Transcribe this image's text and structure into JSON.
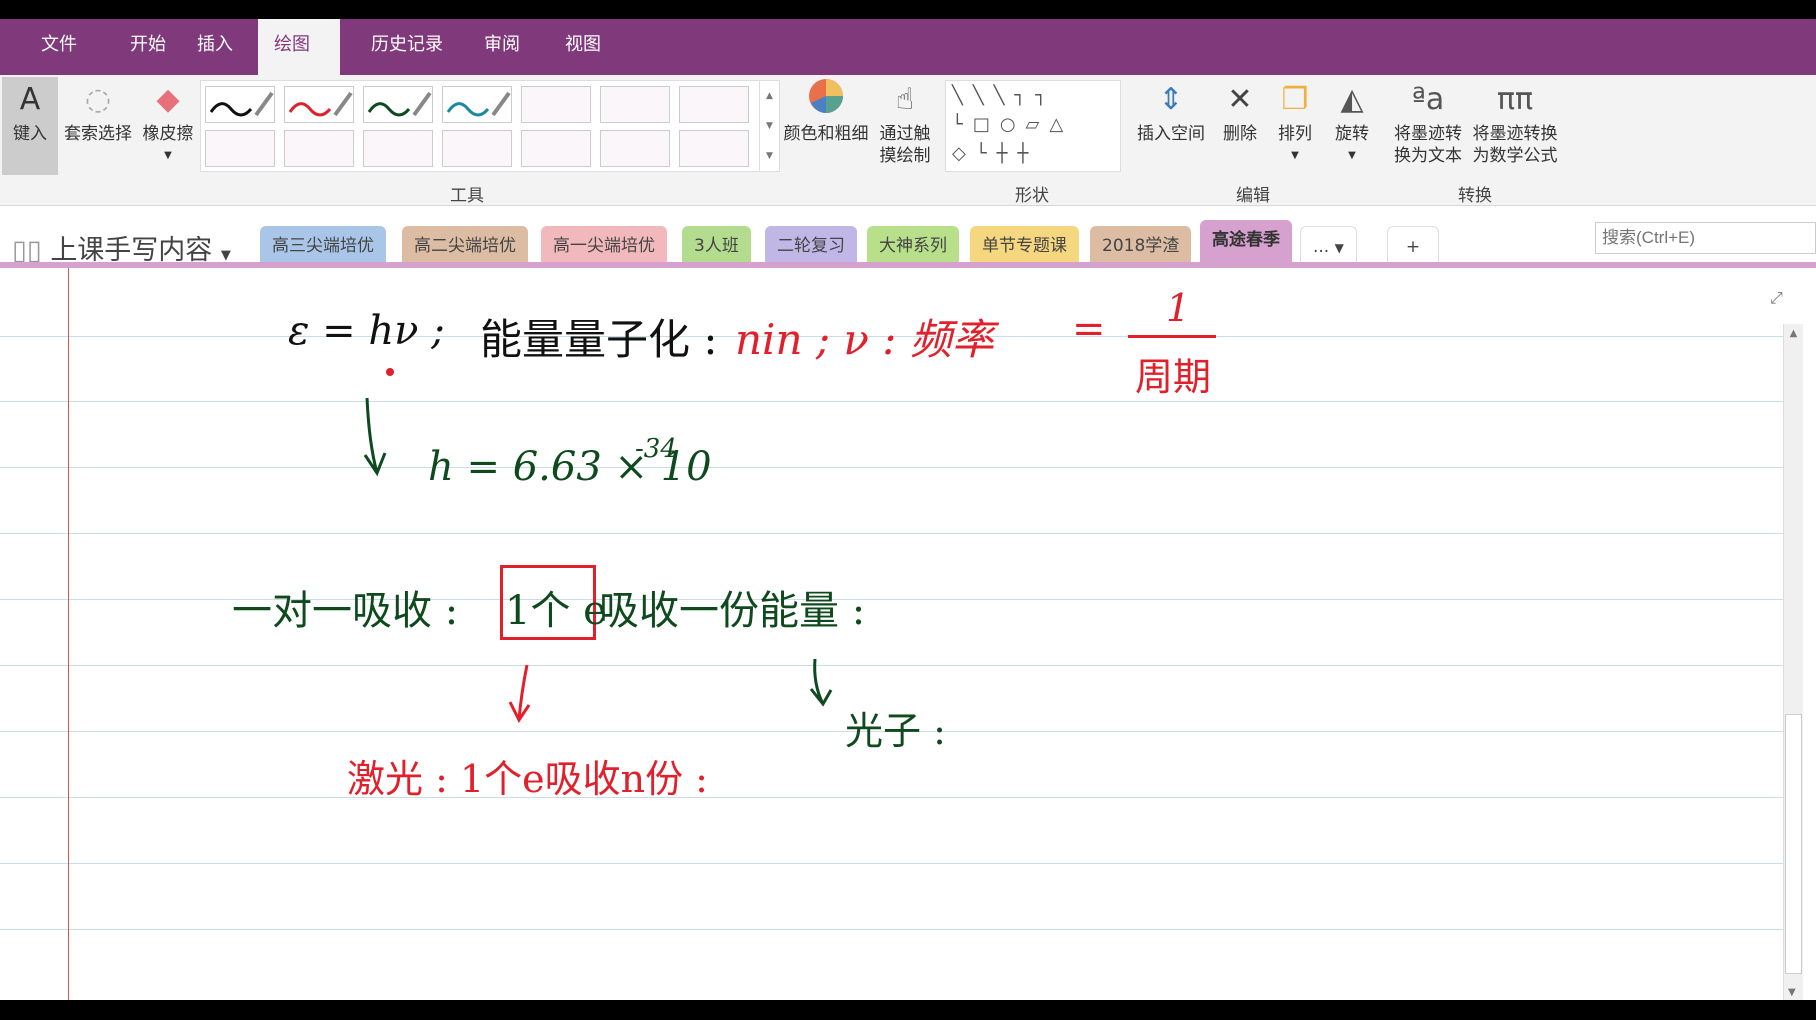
{
  "menu": [
    "文件",
    "开始",
    "插入",
    "绘图",
    "历史记录",
    "审阅",
    "视图"
  ],
  "ribbon": {
    "type": "键入",
    "lasso": "套索选择",
    "eraser": "橡皮擦",
    "tools_group": "工具",
    "color_width": "颜色和粗细",
    "touch_draw_1": "通过触",
    "touch_draw_2": "摸绘制",
    "shapes_group": "形状",
    "insert_space": "插入空间",
    "delete": "删除",
    "arrange": "排列",
    "rotate": "旋转",
    "edit_group": "编辑",
    "ink_text_1": "将墨迹转",
    "ink_text_2": "换为文本",
    "ink_math_1": "将墨迹转换",
    "ink_math_2": "为数学公式",
    "convert_group": "转换",
    "pen_colors": [
      "#111111",
      "#e0202a",
      "#0e4a1e",
      "#1a8aa0"
    ]
  },
  "notebook": {
    "name": "上课手写内容"
  },
  "sections": [
    {
      "label": "高三尖端培优",
      "color": "#a9c6e8"
    },
    {
      "label": "高二尖端培优",
      "color": "#dcbda4"
    },
    {
      "label": "高一尖端培优",
      "color": "#f1b9bc"
    },
    {
      "label": "3人班",
      "color": "#b4dc8e"
    },
    {
      "label": "二轮复习",
      "color": "#c0b7e6"
    },
    {
      "label": "大神系列",
      "color": "#b8e08a"
    },
    {
      "label": "单节专题课",
      "color": "#f4d77f"
    },
    {
      "label": "2018学渣",
      "color": "#dcbda4"
    },
    {
      "label": "高途春季",
      "color": "#d6a0cf"
    }
  ],
  "more_tabs": "...",
  "add_tab": "+",
  "search": {
    "placeholder": "搜索(Ctrl+E)"
  },
  "ink": {
    "l1": "ε = hν ;",
    "l2": "能量量子化 :",
    "l3": "nin ; ν : 频率",
    "l4": "=",
    "num": "1",
    "den": "周期",
    "l5": "h = 6.63 × 10",
    "exp": "-34",
    "l6": "一对一吸收 :",
    "box": "1个 e",
    "l7": "吸收一份能量 :",
    "l8": "光子 :",
    "l9": "激光 : 1个e吸收n份 :"
  }
}
